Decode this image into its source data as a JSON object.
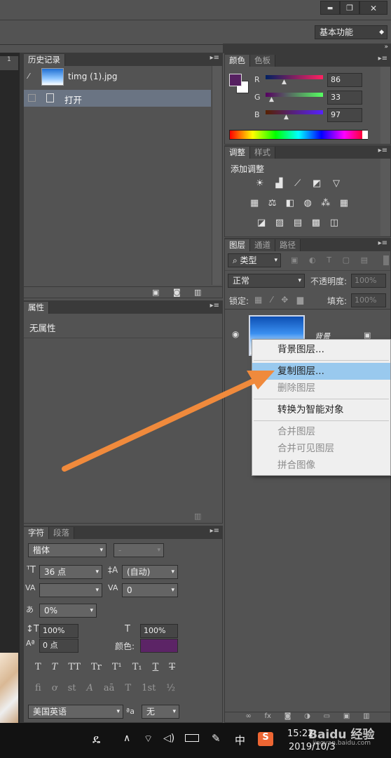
{
  "title_bar": {
    "minimize": "▬",
    "restore": "❐",
    "close": "✕"
  },
  "workspace": {
    "value": "基本功能",
    "ruler_tick": "1"
  },
  "history": {
    "tab": "历史记录",
    "snapshot_name": "timg (1).jpg",
    "step": "打开"
  },
  "properties": {
    "tab": "属性",
    "text": "无属性"
  },
  "color": {
    "tabs": [
      "颜色",
      "色板"
    ],
    "r_label": "R",
    "g_label": "G",
    "b_label": "B",
    "r": "86",
    "g": "33",
    "b": "97",
    "fg": "#562161"
  },
  "adjust": {
    "tabs": [
      "调整",
      "样式"
    ],
    "title": "添加调整"
  },
  "layers": {
    "tabs": [
      "图层",
      "通道",
      "路径"
    ],
    "filter": "类型",
    "blend": "正常",
    "opacity_label": "不透明度:",
    "opacity": "100%",
    "lock_label": "锁定:",
    "fill_label": "填充:",
    "fill": "100%",
    "layer_name": "背景"
  },
  "context_menu": {
    "items": [
      "背景图层...",
      "复制图层...",
      "删除图层",
      "转换为智能对象",
      "合并图层",
      "合并可见图层",
      "拼合图像"
    ]
  },
  "character": {
    "tabs": [
      "字符",
      "段落"
    ],
    "font": "楷体",
    "style": "-",
    "size": "36 点",
    "leading": "(自动)",
    "kerning": "",
    "tracking": "0",
    "scale": "0%",
    "vscale": "100%",
    "hscale": "100%",
    "baseline": "0 点",
    "color_label": "颜色:",
    "color": "#5c2466",
    "language": "美国英语",
    "aa_label": "a",
    "aa": "无"
  },
  "taskbar": {
    "ime": "中",
    "time": "15:22",
    "date": "2019/10/3",
    "watermark": "Baidu 经验",
    "watermark_url": "jingyan.baidu.com"
  }
}
